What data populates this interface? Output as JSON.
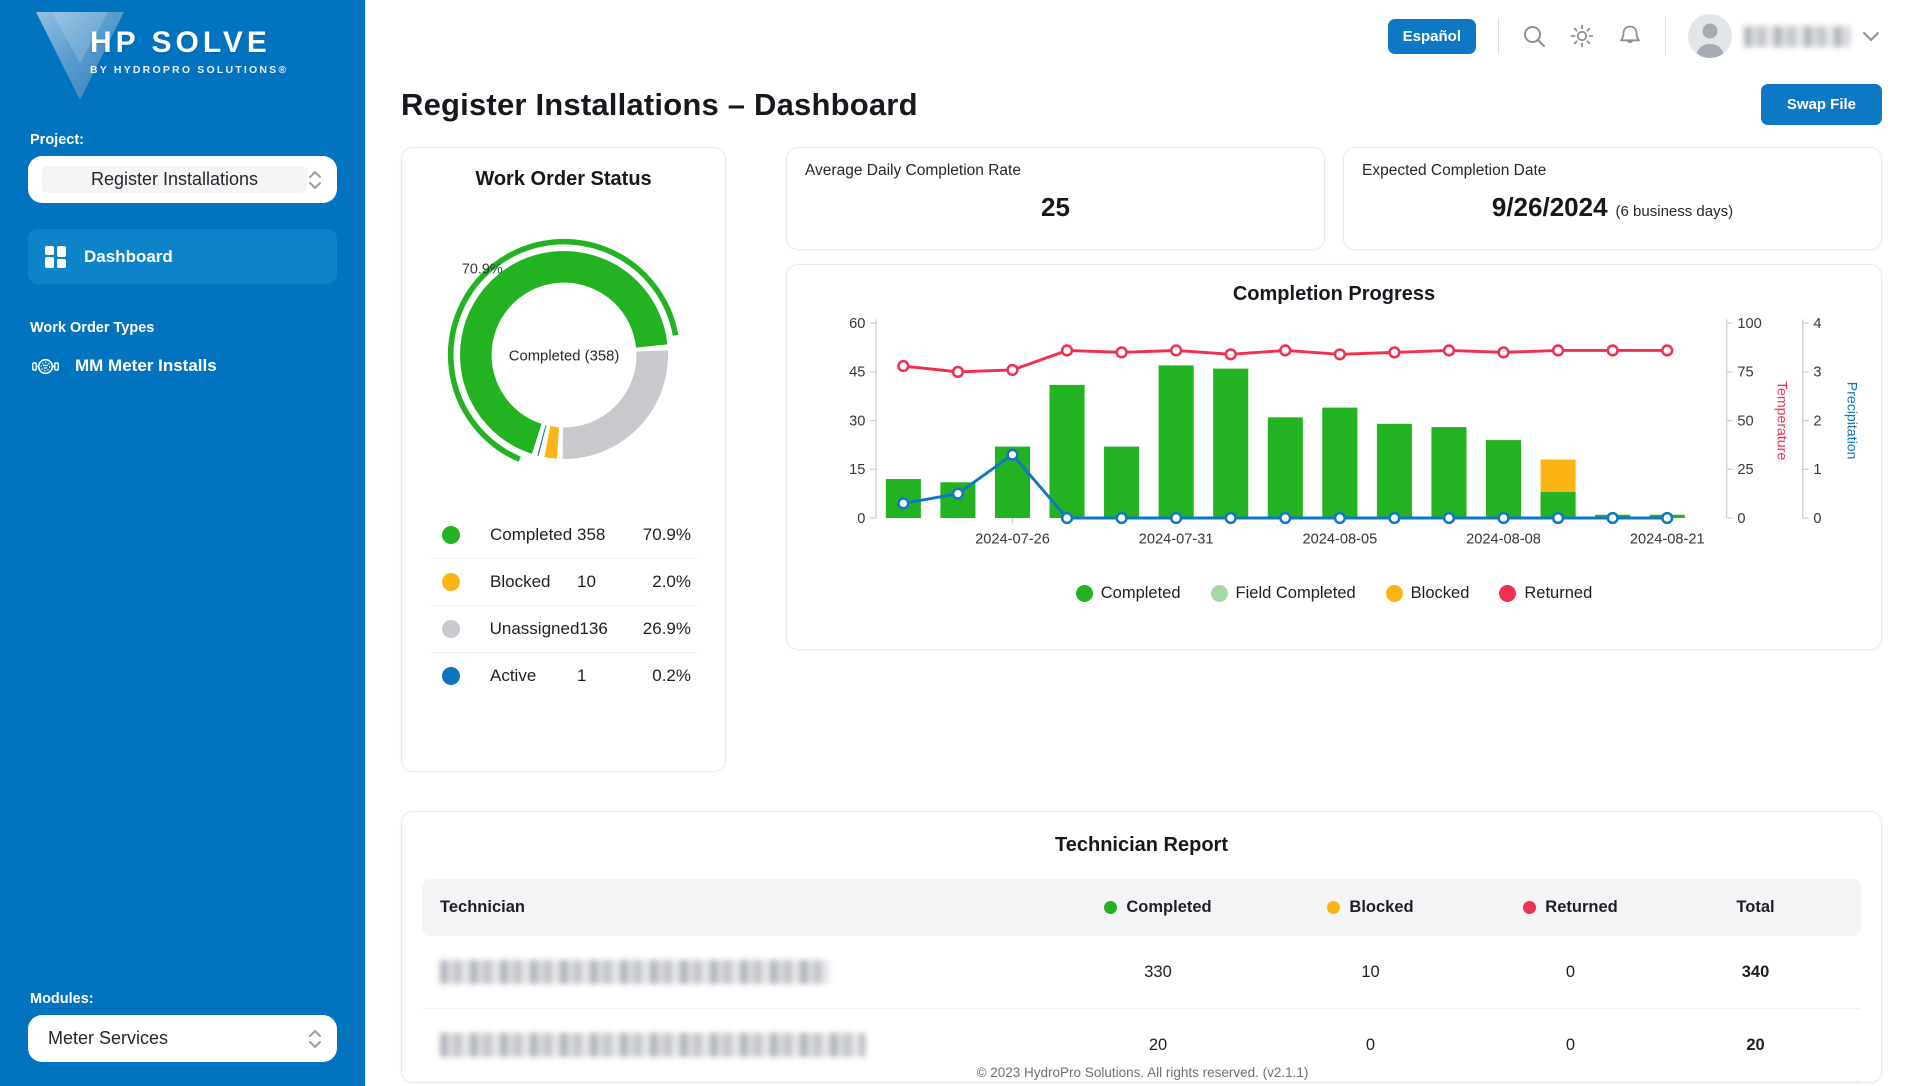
{
  "sidebar": {
    "logo_title": "HP SOLVE",
    "logo_subtitle": "BY HYDROPRO SOLUTIONS®",
    "project_label": "Project:",
    "project_select": "Register Installations",
    "nav_dashboard": "Dashboard",
    "work_order_types_label": "Work Order Types",
    "work_order_item": "MM Meter Installs",
    "modules_label": "Modules:",
    "modules_select": "Meter Services"
  },
  "topbar": {
    "language_button": "Español"
  },
  "page": {
    "title": "Register Installations – Dashboard",
    "swap_file_button": "Swap File"
  },
  "work_order_status": {
    "title": "Work Order Status",
    "center_label": "Completed (358)",
    "callout_percent": "70.9%",
    "legend": [
      {
        "label": "Completed",
        "count": "358",
        "percent": "70.9%",
        "color": "#22b222"
      },
      {
        "label": "Blocked",
        "count": "10",
        "percent": "2.0%",
        "color": "#fcb415"
      },
      {
        "label": "Unassigned",
        "count": "136",
        "percent": "26.9%",
        "color": "#c9c9cd"
      },
      {
        "label": "Active",
        "count": "1",
        "percent": "0.2%",
        "color": "#0d74be"
      }
    ]
  },
  "stats": [
    {
      "label": "Average Daily Completion Rate",
      "value": "25",
      "suffix": ""
    },
    {
      "label": "Expected Completion Date",
      "value": "9/26/2024",
      "suffix": "(6 business days)"
    }
  ],
  "chart_data": [
    {
      "type": "pie",
      "title": "Work Order Status",
      "labels": [
        "Completed",
        "Blocked",
        "Unassigned",
        "Active"
      ],
      "values": [
        358,
        10,
        136,
        1
      ],
      "percents": [
        70.9,
        2.0,
        26.9,
        0.2
      ],
      "colors": [
        "#22b222",
        "#fcb415",
        "#c9c9cd",
        "#0d74be"
      ],
      "center_label": "Completed (358)",
      "callout": "70.9%"
    },
    {
      "type": "bar+line",
      "title": "Completion Progress",
      "n_points": 15,
      "x_tick_labels": [
        {
          "index": 2,
          "label": "2024-07-26"
        },
        {
          "index": 5,
          "label": "2024-07-31"
        },
        {
          "index": 8,
          "label": "2024-08-05"
        },
        {
          "index": 11,
          "label": "2024-08-08"
        },
        {
          "index": 14,
          "label": "2024-08-21"
        }
      ],
      "left_axis": {
        "ticks": [
          0,
          15,
          30,
          45,
          60
        ],
        "max": 60
      },
      "right_axis_temperature": {
        "name": "Temperature",
        "ticks": [
          0,
          25,
          50,
          75,
          100
        ],
        "max": 100,
        "color": "#ee3150"
      },
      "right_axis_precipitation": {
        "name": "Precipitation",
        "ticks": [
          0,
          1,
          2,
          3,
          4
        ],
        "max": 4,
        "color": "#0f78c4"
      },
      "series": [
        {
          "name": "Completed",
          "type": "bar",
          "color": "#22b222",
          "axis": "left",
          "values": [
            12,
            11,
            22,
            41,
            22,
            47,
            46,
            31,
            34,
            29,
            28,
            24,
            8,
            1,
            1
          ]
        },
        {
          "name": "Field Completed",
          "type": "bar",
          "color": "#a7d7a7",
          "axis": "left",
          "values": [
            0,
            0,
            0,
            0,
            0,
            0,
            0,
            0,
            0,
            0,
            0,
            0,
            0,
            0,
            0
          ]
        },
        {
          "name": "Blocked",
          "type": "bar",
          "color": "#fcb415",
          "axis": "left",
          "values": [
            0,
            0,
            0,
            0,
            0,
            0,
            0,
            0,
            0,
            0,
            0,
            0,
            10,
            0,
            0
          ]
        },
        {
          "name": "Returned",
          "type": "bar",
          "color": "#ee3150",
          "axis": "left",
          "values": [
            0,
            0,
            0,
            0,
            0,
            0,
            0,
            0,
            0,
            0,
            0,
            0,
            0,
            0,
            0
          ]
        },
        {
          "name": "Temperature",
          "type": "line",
          "color": "#ee3150",
          "axis": "temperature",
          "values": [
            78,
            75,
            76,
            86,
            85,
            86,
            84,
            86,
            84,
            85,
            86,
            85,
            86,
            86,
            86
          ]
        },
        {
          "name": "Precipitation",
          "type": "line",
          "color": "#0f78c4",
          "axis": "precipitation",
          "values": [
            0.3,
            0.5,
            1.3,
            0,
            0,
            0,
            0,
            0,
            0,
            0,
            0,
            0,
            0,
            0,
            0
          ]
        }
      ],
      "legend": [
        {
          "label": "Completed",
          "color": "#22b222"
        },
        {
          "label": "Field Completed",
          "color": "#a7d7a7"
        },
        {
          "label": "Blocked",
          "color": "#fcb415"
        },
        {
          "label": "Returned",
          "color": "#ee3150"
        }
      ]
    }
  ],
  "completion_progress_title": "Completion Progress",
  "technician_report": {
    "title": "Technician Report",
    "columns": {
      "technician": "Technician",
      "completed": "Completed",
      "blocked": "Blocked",
      "returned": "Returned",
      "total": "Total"
    },
    "dot_colors": {
      "completed": "#22b222",
      "blocked": "#fcb415",
      "returned": "#ee3150"
    },
    "rows": [
      {
        "technician_redacted": true,
        "completed": "330",
        "blocked": "10",
        "returned": "0",
        "total": "340"
      },
      {
        "technician_redacted": true,
        "completed": "20",
        "blocked": "0",
        "returned": "0",
        "total": "20"
      }
    ]
  },
  "footer": {
    "copyright": "© 2023 HydroPro Solutions. All rights reserved. (v2.1.1)"
  }
}
